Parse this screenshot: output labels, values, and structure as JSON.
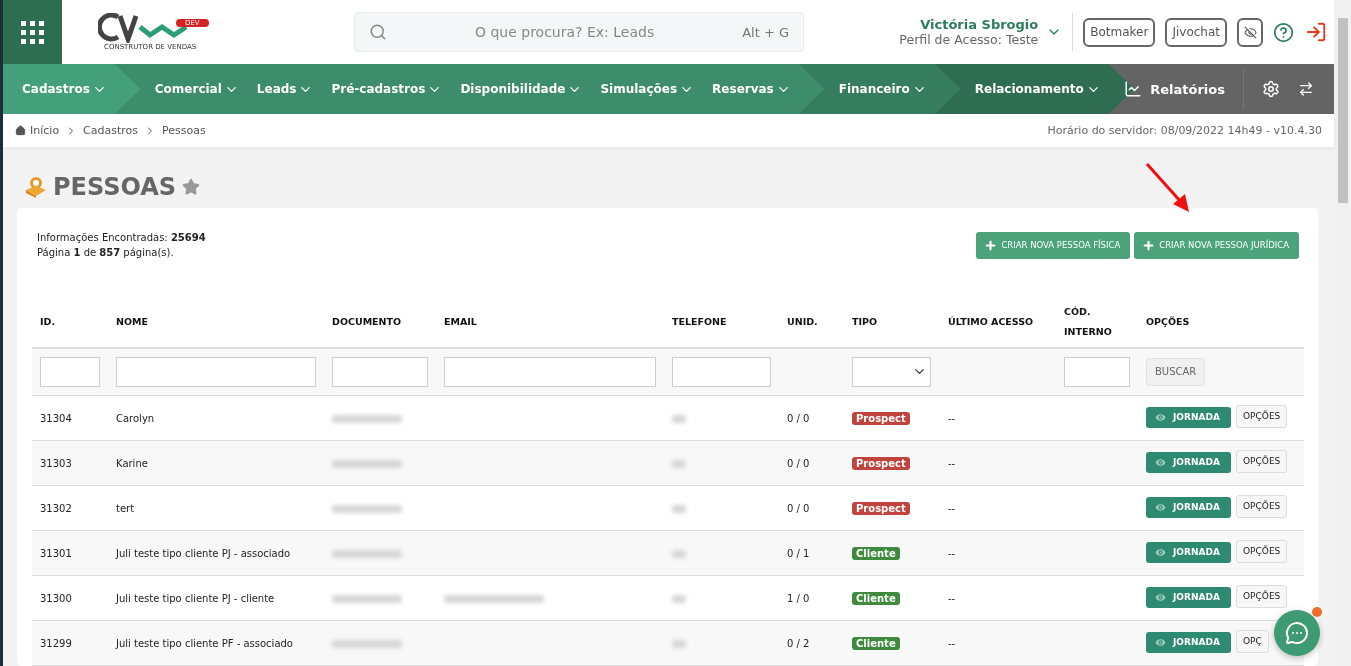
{
  "header": {
    "search": {
      "placeholder": "O que procura? Ex: Leads",
      "shortcut": "Alt + G"
    },
    "logo": {
      "badge": "DEV",
      "tagline": "CONSTRUTOR DE VENDAS"
    },
    "user": {
      "name": "Victória Sbrogio",
      "profile": "Perfil de Acesso: Teste"
    },
    "buttons": [
      "Botmaker",
      "Jivochat"
    ]
  },
  "nav": {
    "groups": [
      {
        "color": "#43a07a",
        "items": [
          {
            "label": "Cadastros"
          }
        ]
      },
      {
        "color": "#3d8c6b",
        "items": [
          {
            "label": "Comercial"
          },
          {
            "label": "Leads"
          },
          {
            "label": "Pré-cadastros"
          },
          {
            "label": "Disponibilidade"
          },
          {
            "label": "Simulações"
          },
          {
            "label": "Reservas"
          }
        ]
      },
      {
        "color": "#367c5e",
        "items": [
          {
            "label": "Financeiro"
          }
        ]
      },
      {
        "color": "#2f6d52",
        "items": [
          {
            "label": "Relacionamento"
          }
        ]
      }
    ],
    "reports": "Relatórios"
  },
  "breadcrumb": [
    "Início",
    "Cadastros",
    "Pessoas"
  ],
  "server_time": "Horário do servidor: 08/09/2022 14h49 - v10.4.30",
  "page_title": "PESSOAS",
  "summary": [
    "Informações Encontradas: **25694**",
    "Página **1** de **857** página(s)."
  ],
  "actions": [
    "CRIAR NOVA PESSOA FÍSICA",
    "CRIAR NOVA PESSOA JURÍDICA"
  ],
  "table": {
    "columns": [
      "ID.",
      "NOME",
      "DOCUMENTO",
      "EMAIL",
      "TELEFONE",
      "UNID.",
      "TIPO",
      "ÚLTIMO ACESSO",
      "CÓD. INTERNO",
      "OPÇÕES"
    ],
    "search_button": "BUSCAR",
    "rows": [
      {
        "id": "31304",
        "name": "Carolyn",
        "blurred_document": true,
        "blurred_email": false,
        "blurred_phone": true,
        "units": "0 / 0",
        "type": "Prospect",
        "color": "#c0443d",
        "last_access": "--",
        "journey": "JORNADA",
        "options": "OPÇÕES"
      },
      {
        "id": "31303",
        "name": "Karine",
        "blurred_document": true,
        "blurred_email": false,
        "blurred_phone": true,
        "units": "0 / 0",
        "type": "Prospect",
        "color": "#c0443d",
        "last_access": "--",
        "journey": "JORNADA",
        "options": "OPÇÕES"
      },
      {
        "id": "31302",
        "name": "tert",
        "blurred_document": true,
        "blurred_email": false,
        "blurred_phone": true,
        "units": "0 / 0",
        "type": "Prospect",
        "color": "#c0443d",
        "last_access": "--",
        "journey": "JORNADA",
        "options": "OPÇÕES"
      },
      {
        "id": "31301",
        "name": "Juli teste tipo cliente PJ - associado",
        "blurred_document": true,
        "blurred_email": false,
        "blurred_phone": true,
        "units": "0 / 1",
        "type": "Cliente",
        "color": "#3f8a3f",
        "last_access": "--",
        "journey": "JORNADA",
        "options": "OPÇÕES"
      },
      {
        "id": "31300",
        "name": "Juli teste tipo cliente PJ - cliente",
        "blurred_document": true,
        "blurred_email": true,
        "blurred_phone": true,
        "units": "1 / 0",
        "type": "Cliente",
        "color": "#3f8a3f",
        "last_access": "--",
        "journey": "JORNADA",
        "options": "OPÇÕES"
      },
      {
        "id": "31299",
        "name": "Juli teste tipo cliente PF - associado",
        "blurred_document": true,
        "blurred_email": false,
        "blurred_phone": true,
        "units": "0 / 2",
        "type": "Cliente",
        "color": "#3f8a3f",
        "last_access": "--",
        "journey": "JORNADA",
        "options": "OPÇ"
      }
    ]
  },
  "chat": {
    "unread": true
  }
}
